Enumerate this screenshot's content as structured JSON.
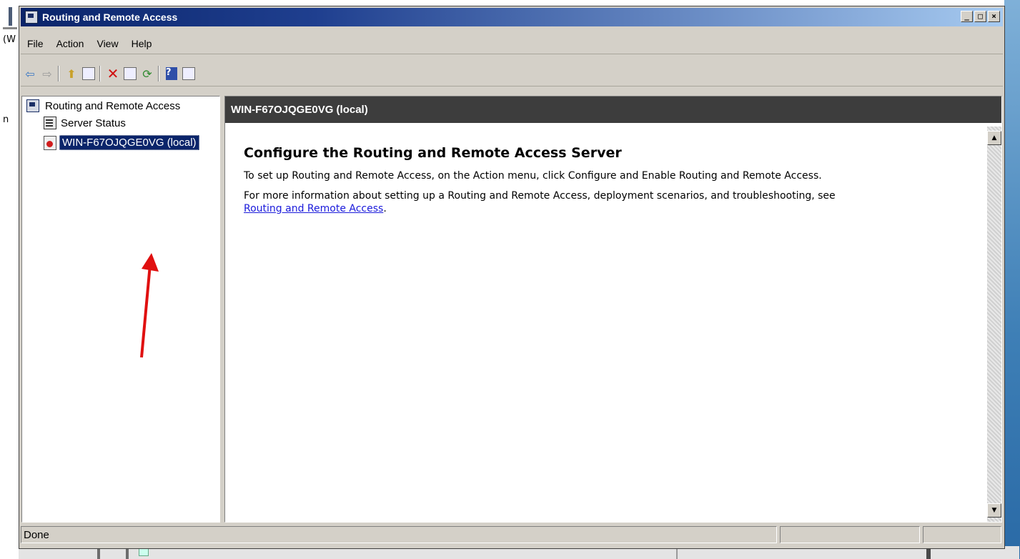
{
  "window": {
    "title": "Routing and Remote Access"
  },
  "window_controls": {
    "minimize": "_",
    "maximize": "□",
    "close": "×"
  },
  "menu": [
    "File",
    "Action",
    "View",
    "Help"
  ],
  "toolbar": [
    "back",
    "forward",
    "up-folder",
    "show-hide-console-tree",
    "delete",
    "properties",
    "refresh",
    "help",
    "show-hide-action-pane"
  ],
  "tree": {
    "root": "Routing and Remote Access",
    "items": [
      "Server Status",
      "WIN-F67OJQGE0VG (local)"
    ],
    "selected": "WIN-F67OJQGE0VG (local)"
  },
  "content": {
    "header": "WIN-F67OJQGE0VG (local)",
    "heading": "Configure the Routing and Remote Access Server",
    "para1": "To set up Routing and Remote Access, on the Action menu, click Configure and Enable Routing and Remote Access.",
    "para2": "For more information about setting up a Routing and Remote Access, deployment scenarios, and troubleshooting, see",
    "link": "Routing and Remote Access",
    "link_suffix": "."
  },
  "status": {
    "text": "Done"
  },
  "background": {
    "fragment1": "(W",
    "fragment2": "n"
  },
  "colors": {
    "titlebar": "#0a246a",
    "selection": "#0a246a",
    "header_bar": "#3d3d3d",
    "link": "#1a1adb",
    "arrow": "#e01010"
  }
}
